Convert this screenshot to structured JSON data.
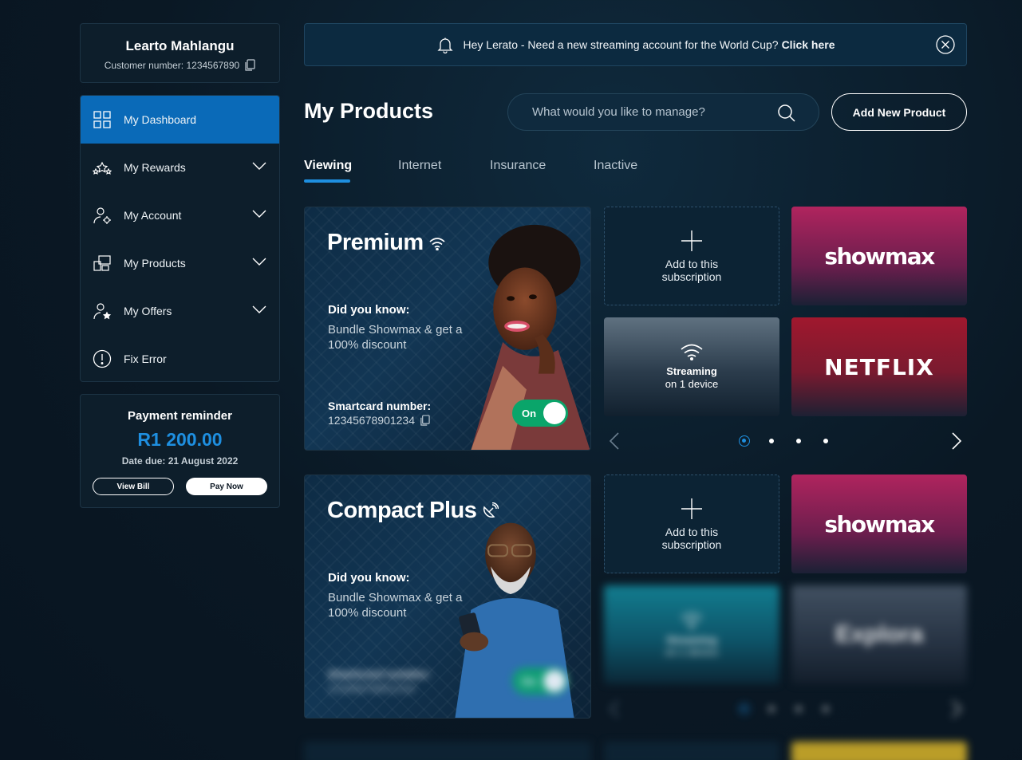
{
  "profile": {
    "name": "Learto Mahlangu",
    "customer_number": "Customer number: 1234567890"
  },
  "nav": {
    "items": [
      {
        "label": "My Dashboard"
      },
      {
        "label": "My Rewards"
      },
      {
        "label": "My Account"
      },
      {
        "label": "My Products"
      },
      {
        "label": "My Offers"
      },
      {
        "label": "Fix Error"
      }
    ]
  },
  "payment": {
    "title": "Payment reminder",
    "amount": "R1 200.00",
    "due": "Date due: 21 August 2022",
    "view_bill": "View Bill",
    "pay_now": "Pay Now"
  },
  "banner": {
    "text": "Hey Lerato - Need a new streaming account for the World Cup?",
    "link": "Click here"
  },
  "header": {
    "title": "My Products",
    "search_placeholder": "What would you like to manage?",
    "add_button": "Add New Product"
  },
  "tabs": [
    {
      "label": "Viewing"
    },
    {
      "label": "Internet"
    },
    {
      "label": "Insurance"
    },
    {
      "label": "Inactive"
    }
  ],
  "products": [
    {
      "title": "Premium",
      "did_you_know": "Did you know:",
      "desc": "Bundle Showmax & get a 100% discount",
      "smartcard_label": "Smartcard number:",
      "smartcard_number": "12345678901234",
      "toggle": "On",
      "tiles": {
        "add_line1": "Add to this",
        "add_line2": "subscription",
        "showmax": "showmax",
        "streaming_line1": "Streaming",
        "streaming_line2": "on 1 device",
        "netflix": "NETFLIX"
      }
    },
    {
      "title": "Compact Plus",
      "did_you_know": "Did you know:",
      "desc": "Bundle Showmax & get a 100% discount",
      "smartcard_label": "Smartcard number:",
      "smartcard_number": "12345678901234",
      "toggle": "On",
      "tiles": {
        "add_line1": "Add to this",
        "add_line2": "subscription",
        "showmax": "showmax",
        "streaming_line1": "Streaming",
        "streaming_line2": "on 1 device",
        "explora": "Explora"
      }
    }
  ],
  "colors": {
    "accent": "#1e8fe0",
    "active_nav": "#0a6ab8",
    "toggle_on": "#0aa56a",
    "showmax": "#b0245e",
    "netflix": "#a0182e"
  }
}
